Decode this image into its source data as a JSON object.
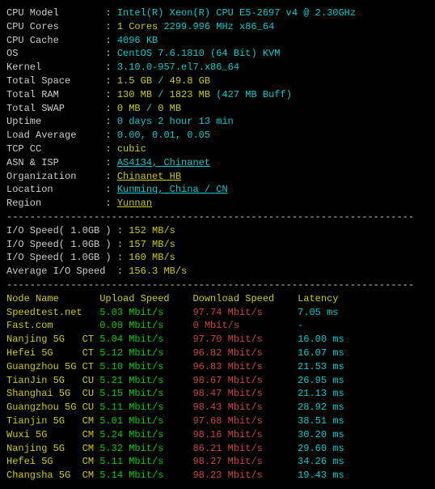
{
  "sys": [
    {
      "label": "CPU Model",
      "value": "Intel(R) Xeon(R) CPU E5-2697 v4 @ 2.30GHz",
      "cls": "cyan"
    },
    {
      "label": "CPU Cores",
      "value_parts": [
        {
          "t": "1 Cores",
          "c": "yellow"
        },
        {
          "t": " 2299.996 MHz ",
          "c": "cyan"
        },
        {
          "t": "x86_64",
          "c": "cyan"
        }
      ]
    },
    {
      "label": "CPU Cache",
      "value": "4096 KB",
      "cls": "cyan"
    },
    {
      "label": "OS",
      "value_parts": [
        {
          "t": "CentOS 7.6.1810 (64 Bit) ",
          "c": "cyan"
        },
        {
          "t": "KVM",
          "c": "cyan"
        }
      ]
    },
    {
      "label": "Kernel",
      "value": "3.10.0-957.el7.x86_64",
      "cls": "cyan"
    },
    {
      "label": "Total Space",
      "value_parts": [
        {
          "t": "1.5 GB",
          "c": "yellow"
        },
        {
          "t": " / ",
          "c": "cyan"
        },
        {
          "t": "49.8 GB",
          "c": "yellow"
        }
      ]
    },
    {
      "label": "Total RAM",
      "value_parts": [
        {
          "t": "130 MB",
          "c": "yellow"
        },
        {
          "t": " / ",
          "c": "cyan"
        },
        {
          "t": "1823 MB",
          "c": "yellow"
        },
        {
          "t": " (427 MB Buff)",
          "c": "cyan"
        }
      ]
    },
    {
      "label": "Total SWAP",
      "value_parts": [
        {
          "t": "0 MB",
          "c": "yellow"
        },
        {
          "t": " / ",
          "c": "cyan"
        },
        {
          "t": "0 MB",
          "c": "yellow"
        }
      ]
    },
    {
      "label": "Uptime",
      "value": "0 days 2 hour 13 min",
      "cls": "cyan"
    },
    {
      "label": "Load Average",
      "value": "0.00, 0.01, 0.05",
      "cls": "cyan"
    },
    {
      "label": "TCP CC",
      "value": "cubic",
      "cls": "yellow"
    },
    {
      "label": "ASN & ISP",
      "value": "AS4134, Chinanet",
      "cls": "cyan underline"
    },
    {
      "label": "Organization",
      "value": "Chinanet HB",
      "cls": "yellow underline"
    },
    {
      "label": "Location",
      "value": "Kunming, China / CN",
      "cls": "cyan underline"
    },
    {
      "label": "Region",
      "value": "Yunnan",
      "cls": "yellow underline"
    }
  ],
  "io": [
    {
      "label": "I/O Speed( 1.0GB )",
      "value": "152 MB/s",
      "cls": "yellow"
    },
    {
      "label": "I/O Speed( 1.0GB )",
      "value": "157 MB/s",
      "cls": "yellow"
    },
    {
      "label": "I/O Speed( 1.0GB )",
      "value": "160 MB/s",
      "cls": "yellow"
    },
    {
      "label": "Average I/O Speed",
      "value": "156.3 MB/s",
      "cls": "yellow"
    }
  ],
  "hdr": {
    "c1": "Node Name",
    "c2": "Upload Speed",
    "c3": "Download Speed",
    "c4": "Latency"
  },
  "speed": [
    {
      "name": "Speedtest.net",
      "up": "5.03 Mbit/s",
      "dn": "97.74 Mbit/s",
      "lat": "7.05 ms"
    },
    {
      "name": "Fast.com",
      "up": "0.00 Mbit/s",
      "dn": "0 Mbit/s",
      "lat": "-"
    },
    {
      "name": "Nanjing 5G   CT",
      "up": "5.04 Mbit/s",
      "dn": "97.70 Mbit/s",
      "lat": "16.00 ms"
    },
    {
      "name": "Hefei 5G     CT",
      "up": "5.12 Mbit/s",
      "dn": "96.82 Mbit/s",
      "lat": "16.07 ms"
    },
    {
      "name": "Guangzhou 5G CT",
      "up": "5.10 Mbit/s",
      "dn": "96.83 Mbit/s",
      "lat": "21.53 ms"
    },
    {
      "name": "TianJin 5G   CU",
      "up": "5.21 Mbit/s",
      "dn": "98.67 Mbit/s",
      "lat": "26.95 ms"
    },
    {
      "name": "Shanghai 5G  CU",
      "up": "5.15 Mbit/s",
      "dn": "98.47 Mbit/s",
      "lat": "21.13 ms"
    },
    {
      "name": "Guangzhou 5G CU",
      "up": "5.11 Mbit/s",
      "dn": "98.43 Mbit/s",
      "lat": "28.92 ms"
    },
    {
      "name": "Tianjin 5G   CM",
      "up": "5.01 Mbit/s",
      "dn": "97.68 Mbit/s",
      "lat": "38.51 ms"
    },
    {
      "name": "Wuxi 5G      CM",
      "up": "5.24 Mbit/s",
      "dn": "98.16 Mbit/s",
      "lat": "30.20 ms"
    },
    {
      "name": "Nanjing 5G   CM",
      "up": "5.32 Mbit/s",
      "dn": "86.21 Mbit/s",
      "lat": "29.60 ms"
    },
    {
      "name": "Hefei 5G     CM",
      "up": "5.11 Mbit/s",
      "dn": "98.27 Mbit/s",
      "lat": "34.26 ms"
    },
    {
      "name": "Changsha 5G  CM",
      "up": "5.14 Mbit/s",
      "dn": "98.23 Mbit/s",
      "lat": "19.43 ms"
    }
  ],
  "dash": "----------------------------------------------------------------------"
}
